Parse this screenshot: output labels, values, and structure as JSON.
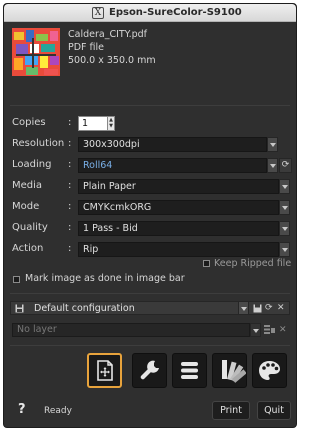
{
  "window": {
    "title": "Epson-SureColor-S9100",
    "logo_glyph": "X"
  },
  "file": {
    "name": "Caldera_CITY.pdf",
    "type": "PDF file",
    "size": "500.0 x 350.0 mm"
  },
  "settings": {
    "copies": {
      "label": "Copies",
      "value": "1"
    },
    "resolution": {
      "label": "Resolution",
      "value": "300x300dpi"
    },
    "loading": {
      "label": "Loading",
      "value": "Roll64"
    },
    "media": {
      "label": "Media",
      "value": "Plain Paper"
    },
    "mode": {
      "label": "Mode",
      "value": "CMYKcmkORG"
    },
    "quality": {
      "label": "Quality",
      "value": "1 Pass - Bid"
    },
    "action": {
      "label": "Action",
      "value": "Rip"
    },
    "colon": ":"
  },
  "options": {
    "keep_ripped": {
      "label": "Keep Ripped file",
      "checked": false
    },
    "mark_done": {
      "label": "Mark image as done in image bar",
      "checked": false
    }
  },
  "configuration": {
    "value": "Default configuration"
  },
  "layer": {
    "placeholder": "No layer"
  },
  "toolbar": {
    "tools": [
      {
        "name": "layout-tool",
        "icon": "page-move-icon",
        "active": true
      },
      {
        "name": "settings-tool",
        "icon": "wrench-icon",
        "active": false
      },
      {
        "name": "list-tool",
        "icon": "stack-icon",
        "active": false
      },
      {
        "name": "color-swatch-tool",
        "icon": "swatches-icon",
        "active": false
      },
      {
        "name": "palette-tool",
        "icon": "palette-icon",
        "active": false
      }
    ]
  },
  "footer": {
    "help": "?",
    "status": "Ready",
    "print_label": "Print",
    "quit_label": "Quit"
  },
  "colors": {
    "panel": "#2f2f2f",
    "accent_active": "#e8a33c",
    "link_blue": "#7ab0e8"
  }
}
